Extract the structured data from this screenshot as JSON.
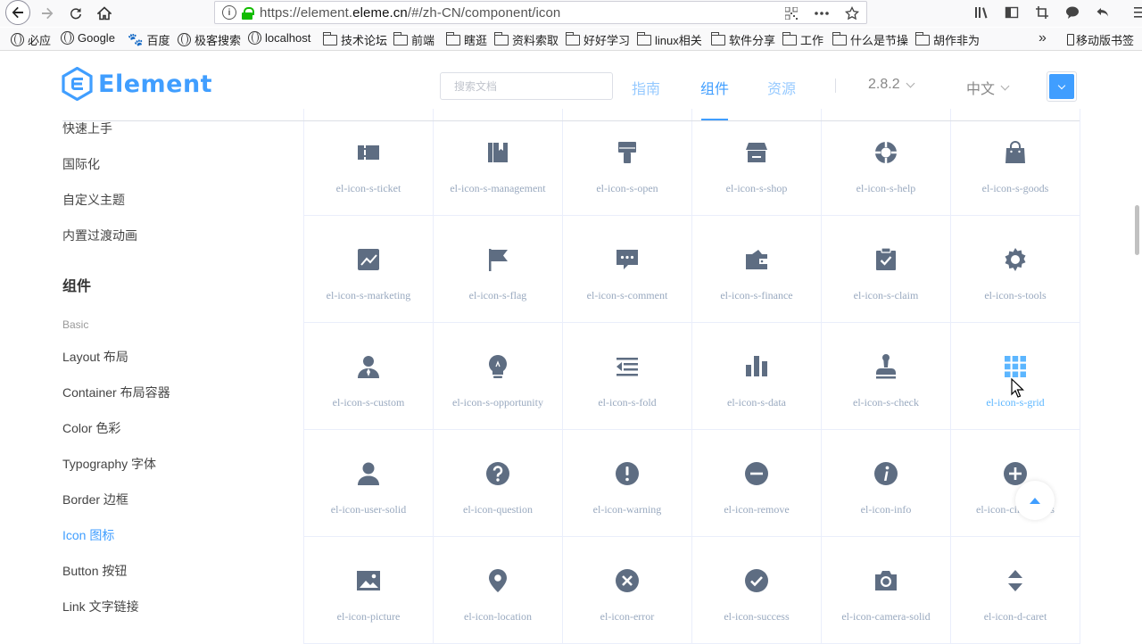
{
  "browser": {
    "url_prefix": "https://element.",
    "url_domain": "eleme.cn",
    "url_suffix": "/#/zh-CN/component/icon"
  },
  "bookmarks": [
    {
      "label": "必应",
      "icon": "globe-icon"
    },
    {
      "label": "Google",
      "icon": "globe-icon"
    },
    {
      "label": "百度",
      "icon": "paw-icon"
    },
    {
      "label": "极客搜索",
      "icon": "globe-icon"
    },
    {
      "label": "localhost",
      "icon": "globe-icon"
    },
    {
      "label": "技术论坛",
      "icon": "folder-icon"
    },
    {
      "label": "前端",
      "icon": "folder-icon"
    },
    {
      "label": "瞎逛",
      "icon": "folder-icon"
    },
    {
      "label": "资料索取",
      "icon": "folder-icon"
    },
    {
      "label": "好好学习",
      "icon": "folder-icon"
    },
    {
      "label": "linux相关",
      "icon": "folder-icon"
    },
    {
      "label": "软件分享",
      "icon": "folder-icon"
    },
    {
      "label": "工作",
      "icon": "folder-icon"
    },
    {
      "label": "什么是节操",
      "icon": "folder-icon"
    },
    {
      "label": "胡作非为",
      "icon": "folder-icon"
    }
  ],
  "bookmarks_more": "»",
  "mobile_bookmarks": "移动版书签",
  "header": {
    "logo_text": "Element",
    "search_placeholder": "搜索文档",
    "nav": [
      "指南",
      "组件",
      "资源"
    ],
    "version": "2.8.2",
    "language": "中文"
  },
  "sidebar": {
    "items_top": [
      "快速上手",
      "国际化",
      "自定义主题",
      "内置过渡动画"
    ],
    "group": "组件",
    "category": "Basic",
    "items_basic": [
      "Layout 布局",
      "Container 布局容器",
      "Color 色彩",
      "Typography 字体",
      "Border 边框",
      "Icon 图标",
      "Button 按钮",
      "Link 文字链接"
    ],
    "active": "Icon 图标"
  },
  "icons": [
    [
      "el-icon-s-ticket",
      "el-icon-s-management",
      "el-icon-s-open",
      "el-icon-s-shop",
      "el-icon-s-help",
      "el-icon-s-goods"
    ],
    [
      "el-icon-s-marketing",
      "el-icon-s-flag",
      "el-icon-s-comment",
      "el-icon-s-finance",
      "el-icon-s-claim",
      "el-icon-s-tools"
    ],
    [
      "el-icon-s-custom",
      "el-icon-s-opportunity",
      "el-icon-s-fold",
      "el-icon-s-data",
      "el-icon-s-check",
      "el-icon-s-grid"
    ],
    [
      "el-icon-user-solid",
      "el-icon-question",
      "el-icon-warning",
      "el-icon-remove",
      "el-icon-info",
      "el-icon-circle-plus"
    ],
    [
      "el-icon-picture",
      "el-icon-location",
      "el-icon-error",
      "el-icon-success",
      "el-icon-camera-solid",
      "el-icon-d-caret"
    ]
  ],
  "hovered_icon": "el-icon-s-grid",
  "colors": {
    "accent": "#409eff",
    "icon": "#5e6d82",
    "label": "#99a9bf"
  }
}
